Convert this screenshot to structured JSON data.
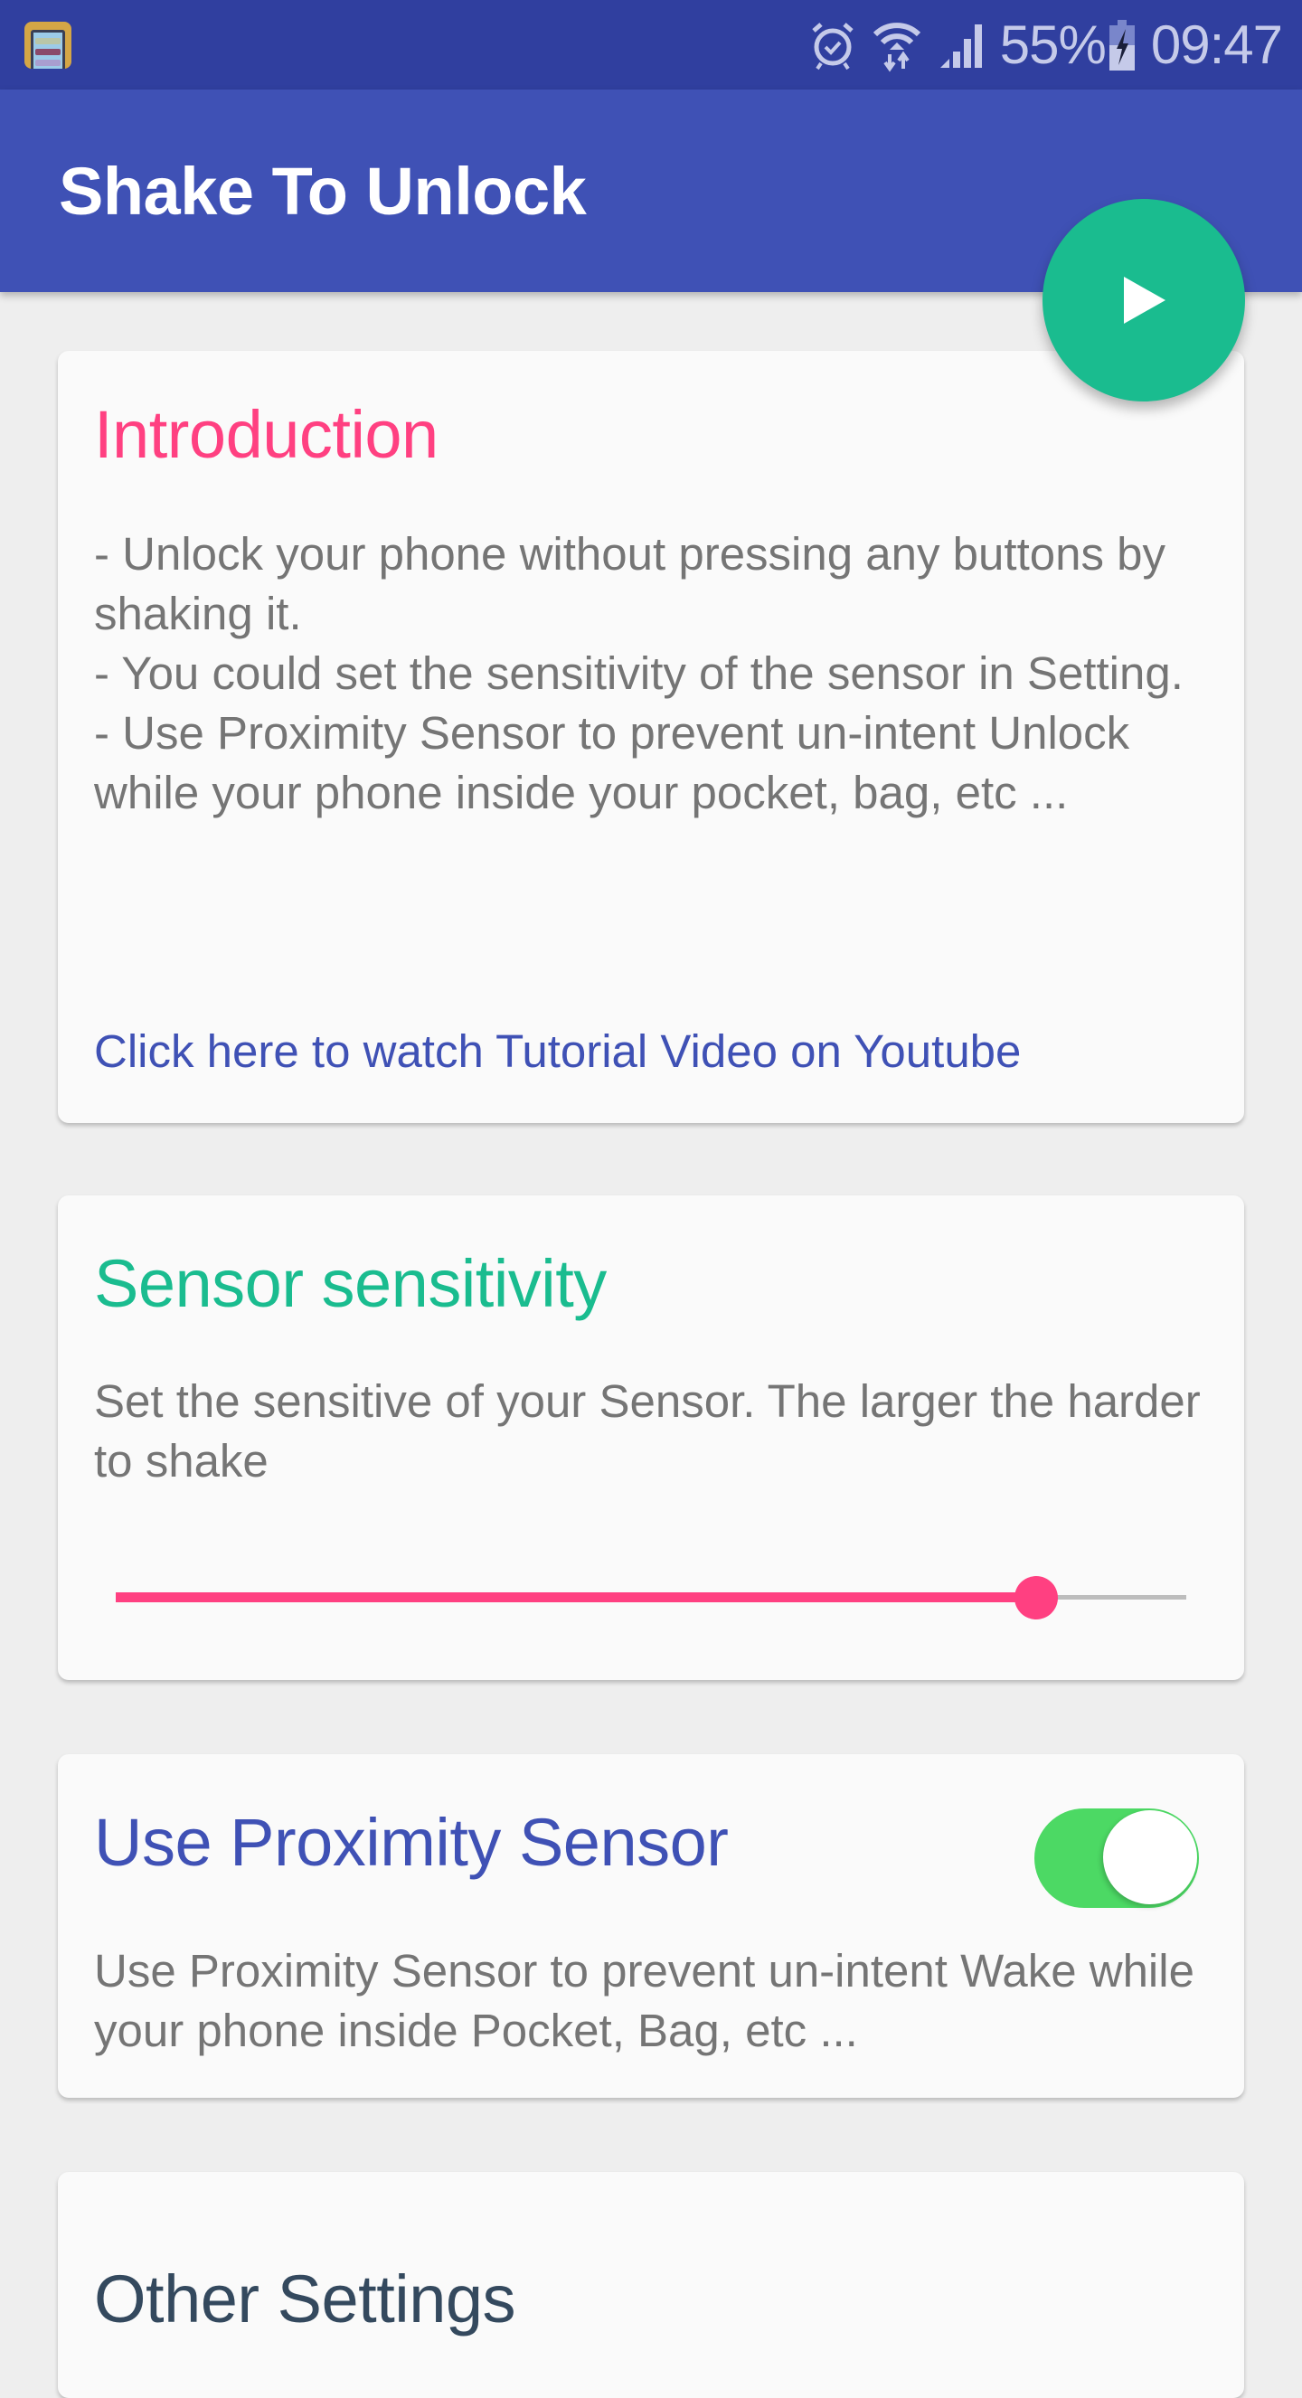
{
  "status_bar": {
    "notification_icon": "app-phone-icon",
    "icons": [
      "alarm-icon",
      "wifi-icon",
      "signal-icon"
    ],
    "battery_percent": "55%",
    "battery_icon": "battery-charging-icon",
    "time": "09:47"
  },
  "app_bar": {
    "title": "Shake To Unlock"
  },
  "fab": {
    "icon": "play-icon",
    "color": "#1abc8f"
  },
  "cards": {
    "intro": {
      "title": "Introduction",
      "body": "- Unlock your phone without pressing any buttons by shaking it.\n- You could set the sensitivity of the sensor in Setting.\n- Use Proximity Sensor to prevent un-intent Unlock while your phone inside your pocket, bag, etc ...",
      "link": "Click here to watch Tutorial Video on Youtube"
    },
    "sensitivity": {
      "title": "Sensor sensitivity",
      "body": "Set the sensitive of your Sensor. The larger the harder to shake",
      "slider_value_fraction": 0.86
    },
    "proximity": {
      "title": "Use Proximity Sensor",
      "body": "Use Proximity Sensor to prevent un-intent Wake while your phone inside Pocket, Bag, etc ...",
      "toggle_on": true
    },
    "other": {
      "title": "Other Settings"
    }
  },
  "colors": {
    "status_bar": "#303f9f",
    "primary": "#3f51b5",
    "accent": "#ff4081",
    "teal": "#1abc8f",
    "toggle_on": "#4cd964",
    "body_text": "#757575",
    "other_title": "#34495e"
  }
}
